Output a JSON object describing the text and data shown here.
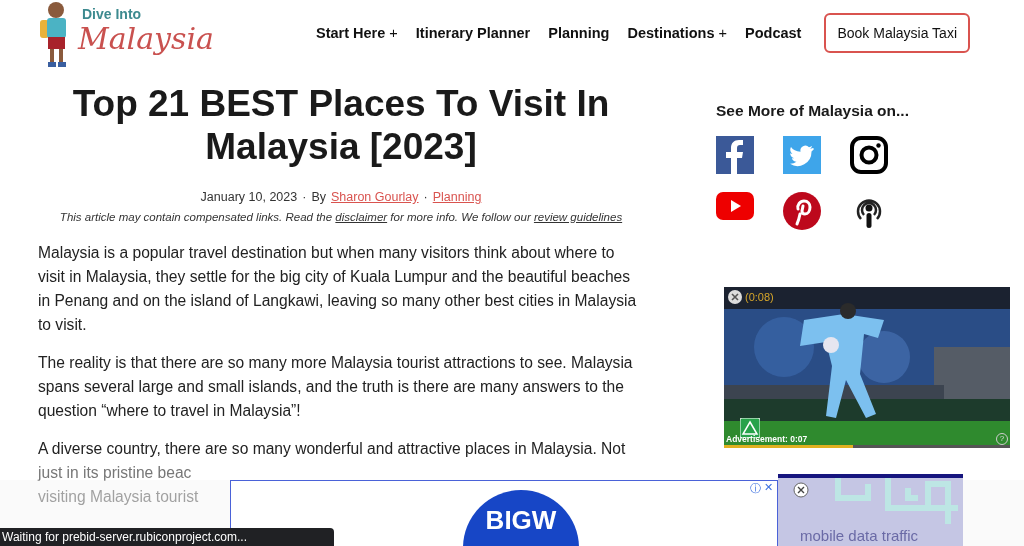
{
  "header": {
    "logo": {
      "line_1": "Dive Into",
      "line_2": "Malaysia"
    },
    "nav": [
      {
        "label": "Start Here",
        "toggle": "+"
      },
      {
        "label": "Itinerary Planner"
      },
      {
        "label": "Planning"
      },
      {
        "label": "Destinations",
        "toggle": "+"
      },
      {
        "label": "Podcast"
      }
    ],
    "cta": "Book Malaysia Taxi"
  },
  "article": {
    "title": "Top 21 BEST Places To Visit In Malaysia [2023]",
    "date": "January 10, 2023",
    "separator": "·",
    "by": "By",
    "author": "Sharon Gourlay",
    "category": "Planning",
    "disclaimer": {
      "before": "This article may contain compensated links. Read the",
      "link_1": "disclaimer",
      "middle": "for more info. We follow our",
      "link_2": "review guidelines"
    },
    "paragraphs": [
      "Malaysia is a popular travel destination but when many visitors think about where to visit in Malaysia, they settle for the big city of Kuala Lumpur and the beautiful beaches in Penang and on the island of Langkawi, leaving so many other best cities in Malaysia to visit.",
      "The reality is that there are so many more Malaysia tourist attractions to see. Malaysia spans several large and small islands, and the truth is there are many answers to the question “where to travel in Malaysia”!"
    ],
    "partial_paragraph": [
      "A diverse country, there are so many wonderful and attractive places in Malaysia. Not",
      "just in its pristine beac",
      "visiting Malaysia tourist"
    ]
  },
  "sidebar": {
    "heading": "See More of Malaysia on...",
    "social": [
      {
        "kind": "facebook"
      },
      {
        "kind": "twitter"
      },
      {
        "kind": "instagram"
      },
      {
        "kind": "youtube"
      },
      {
        "kind": "pinterest"
      },
      {
        "kind": "podcast"
      }
    ],
    "video_ad": {
      "timer": "(0:08)",
      "caption": "Advertisement: 0:07",
      "help": "?",
      "level": 0.45
    }
  },
  "bottom_ad": {
    "brand": "BIGW",
    "info": "ⓘ",
    "close": "✕",
    "side_text": "mobile data traffic"
  },
  "status_bar": "Waiting for prebid-server.rubiconproject.com..."
}
